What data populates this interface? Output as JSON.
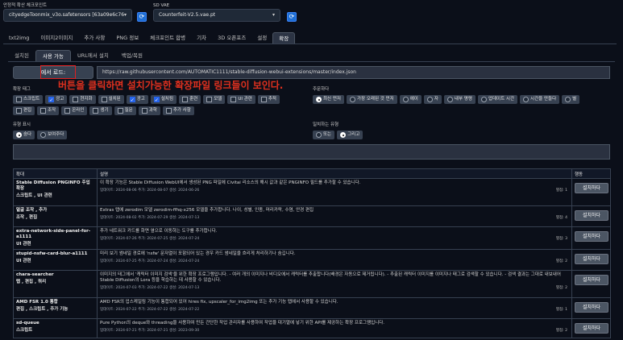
{
  "checkpoint": {
    "label": "안정적 확산 체크포인트",
    "value": "cityedgeToonmix_v3o.safetensors [63a09e6c76"
  },
  "vae": {
    "label": "SD VAE",
    "value": "Counterfeit-V2.5.vae.pt"
  },
  "main_tabs": [
    "txt2img",
    "이미지2이미지",
    "추가 사항",
    "PNG 정보",
    "체크포인트 합병",
    "기차",
    "3D 오픈포즈",
    "설정",
    "확장"
  ],
  "sub_tabs": [
    "설치된",
    "사용 가능",
    "URL에서 설치",
    "백업/복원"
  ],
  "load_button": "에서 로드:",
  "url": "https://raw.githubusercontent.com/AUTOMATIC1111/stable-diffusion-webui-extensions/master/index.json",
  "annotation": "버튼을 클릭하면 설치가능한 확장파일 링크들이 보인다.",
  "filter_label": "확장 태그",
  "filter_chips": [
    {
      "label": "스크립트",
      "checked": false
    },
    {
      "label": "광고",
      "checked": true
    },
    {
      "label": "현지화",
      "checked": false
    },
    {
      "label": "설치된",
      "checked": false
    },
    {
      "label": "광고",
      "checked": true
    },
    {
      "label": "설치됨",
      "checked": true
    },
    {
      "label": "훈련",
      "checked": false
    },
    {
      "label": "모델",
      "checked": false
    },
    {
      "label": "UI 관련",
      "checked": false
    },
    {
      "label": "추적",
      "checked": false
    },
    {
      "label": "편집",
      "checked": false
    },
    {
      "label": "조작",
      "checked": false
    },
    {
      "label": "온라인",
      "checked": false
    },
    {
      "label": "생기",
      "checked": false
    },
    {
      "label": "질문",
      "checked": false
    },
    {
      "label": "과학",
      "checked": false
    },
    {
      "label": "추가 사항",
      "checked": false
    }
  ],
  "sort_label": "주문하다",
  "sort_chips": [
    {
      "label": "최신 먼저",
      "selected": true
    },
    {
      "label": "가장 오래된 것 먼저",
      "selected": false
    },
    {
      "label": "에이",
      "selected": false
    },
    {
      "label": "자",
      "selected": false
    },
    {
      "label": "내부 명령",
      "selected": false
    },
    {
      "label": "업데이트 시간",
      "selected": false
    },
    {
      "label": "시간을 만들다",
      "selected": false
    },
    {
      "label": "별",
      "selected": false
    }
  ],
  "hide_label": "유형 표시",
  "hide_chips": [
    {
      "label": "숨다",
      "selected": true
    },
    {
      "label": "보여주다",
      "selected": false
    }
  ],
  "match_label": "일치하는 유형",
  "match_chips": [
    {
      "label": "또는",
      "selected": false
    },
    {
      "label": "그리고",
      "selected": true
    }
  ],
  "table": {
    "headers": [
      "확대",
      "설명",
      "행동"
    ],
    "rows": [
      {
        "name": "Stable Diffusion PNGINFO 주입 확장",
        "tags": "스크립트 , UI 관련",
        "desc": "이 확장 기능은 Stable Diffusion WebUI에서 생성된 PNG 파일에 Civitai 리소스의 해시 값과 같은 PNGINFO 필드를 추가할 수 있습니다.",
        "dates": "업데이트: 2024-08-06 추가: 2024-08-07 생성: 2024-06-26",
        "stars": "별점: 1",
        "action": "설치하다"
      },
      {
        "name": "얼굴 조작 , 추가",
        "tags": "조작 , 편집",
        "desc": "Extras 탭에 zerodim 모델 zerodim-ffhq-x256 모델을 추가합니다. 나이, 성별, 인종, 머리카락, 수염, 안경 편집",
        "dates": "업데이트: 2024-08-02 추가: 2024-07-29 생성: 2024-07-13",
        "stars": "별점: 4",
        "action": "설치하다"
      },
      {
        "name": "extra-network-side-panel-for-a1111",
        "tags": "UI 관련",
        "desc": "추가 네트워크 카드를 화면 옆으로 이동하는 도구를 추가합니다.",
        "dates": "업데이트: 2024-07-26 추가: 2024-07-25 생성: 2024-07-24",
        "stars": "별점: 3",
        "action": "설치하다"
      },
      {
        "name": "stupid-nsfw-card-blur-a1111",
        "tags": "UI 관련",
        "desc": "미리 보기 썸네일 경로에 'nsfw' 문자열이 포함되어 있는 경우 카드 썸네일을 흐리게 처리하기나 숨깁니다.",
        "dates": "업데이트: 2024-07-25 추가: 2024-07-24 생성: 2024-07-24",
        "stars": "별점: 2",
        "action": "설치하다"
      },
      {
        "name": "chara-searcher",
        "tags": "탭 , 편집 , 쿼리",
        "desc": "이미지의 태그에서 '캐릭터 이미지 검색'을 위한 확장 프로그램입니다. - 여러 개의 이미지나 비디오에서 캐릭터를 추출합니다(배경은 자동으로 제거됩니다). - 추출된 캐릭터 이미지를 이미지나 태그로 검색할 수 있습니다. - 검색 결과는 그대로 내보내어 Stable Diffusion의 Lora 등을 학습하는 데 사용할 수 있습니다.",
        "dates": "업데이트: 2024-07-03 추가: 2024-07-22 생성: 2024-07-13",
        "stars": "별점: 2",
        "action": "설치하다"
      },
      {
        "name": "AMD FSR 1.0 통합",
        "tags": "편집 , 스크립트 , 추가 기능",
        "desc": "AMD FSR의 업스케일링 기능이 통합되어 있어 hires fix, upscaler_for_img2img 또는 추가 기능 탭에서 사용할 수 있습니다.",
        "dates": "업데이트: 2024-07-22 추가: 2024-07-22 생성: 2024-07-22",
        "stars": "별점: 1",
        "action": "설치하다"
      },
      {
        "name": "sd-queue",
        "tags": "스크립트",
        "desc": "Pure Python의 deque와 threading을 사용하여 만든 간단한 작업 관리자를 사용하여 작업을 대기열에 넣기 위한 API를 제공하는 확장 프로그램입니다.",
        "dates": "업데이트: 2024-07-21 추가: 2024-07-21 생성: 2023-09-30",
        "stars": "별점: 2",
        "action": "설치하다"
      }
    ]
  },
  "colors": {
    "background": "#0b0f19",
    "accent": "#1e6fd6",
    "annotation": "#e0301e"
  }
}
